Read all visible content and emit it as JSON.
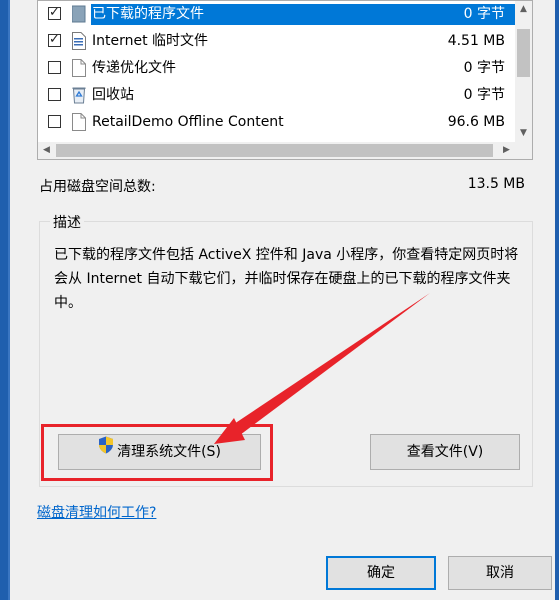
{
  "file_list": {
    "items": [
      {
        "name": "已下载的程序文件",
        "size": "0 字节",
        "checked": true,
        "selected": true,
        "icon": "folder-icon"
      },
      {
        "name": "Internet 临时文件",
        "size": "4.51 MB",
        "checked": true,
        "selected": false,
        "icon": "document-lines-icon"
      },
      {
        "name": "传递优化文件",
        "size": "0 字节",
        "checked": false,
        "selected": false,
        "icon": "blank-file-icon"
      },
      {
        "name": "回收站",
        "size": "0 字节",
        "checked": false,
        "selected": false,
        "icon": "recycle-bin-icon"
      },
      {
        "name": "RetailDemo Offline Content",
        "size": "96.6 MB",
        "checked": false,
        "selected": false,
        "icon": "blank-file-icon"
      }
    ]
  },
  "total": {
    "label": "占用磁盘空间总数:",
    "value": "13.5 MB"
  },
  "description": {
    "title": "描述",
    "text": "已下载的程序文件包括 ActiveX 控件和 Java 小程序，你查看特定网页时将会从 Internet 自动下载它们，并临时保存在硬盘上的已下载的程序文件夹中。"
  },
  "buttons": {
    "cleanup": "清理系统文件(S)",
    "view_files": "查看文件(V)",
    "ok": "确定",
    "cancel": "取消"
  },
  "help_link": "磁盘清理如何工作?",
  "colors": {
    "selection": "#0078d7",
    "annotation": "#e8232a",
    "link": "#0066cc"
  }
}
